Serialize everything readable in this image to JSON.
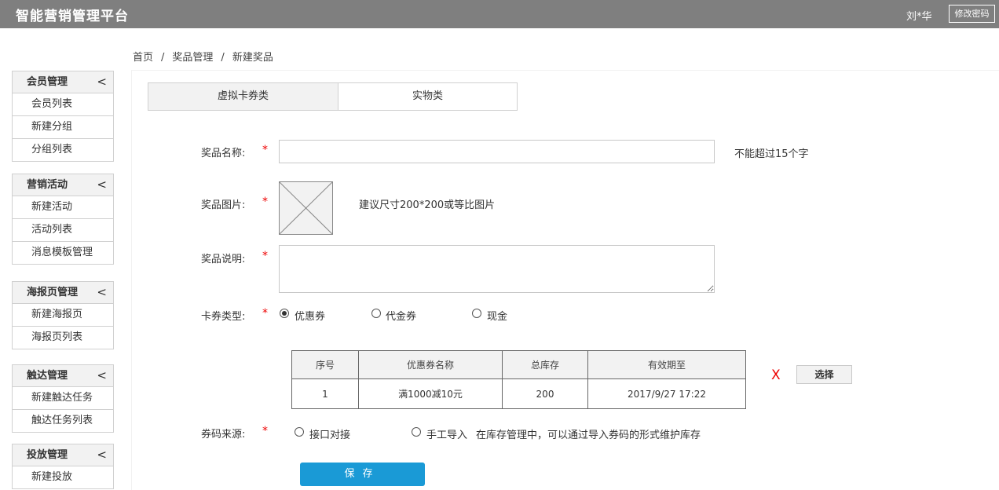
{
  "header": {
    "title": "智能营销管理平台",
    "user": "刘*华",
    "change_password": "修改密码"
  },
  "breadcrumb": {
    "items": [
      "首页",
      "奖品管理",
      "新建奖品"
    ],
    "separator": "/"
  },
  "sidebar": {
    "chevron": "<",
    "groups": [
      {
        "title": "会员管理",
        "items": [
          "会员列表",
          "新建分组",
          "分组列表"
        ]
      },
      {
        "title": "营销活动",
        "items": [
          "新建活动",
          "活动列表",
          "消息模板管理"
        ]
      },
      {
        "title": "海报页管理",
        "items": [
          "新建海报页",
          "海报页列表"
        ]
      },
      {
        "title": "触达管理",
        "items": [
          "新建触达任务",
          "触达任务列表"
        ]
      },
      {
        "title": "投放管理",
        "items": [
          "新建投放"
        ]
      }
    ]
  },
  "tabs": [
    {
      "label": "虚拟卡券类",
      "active": true
    },
    {
      "label": "实物类",
      "active": false
    }
  ],
  "form": {
    "required_mark": "*",
    "name": {
      "label": "奖品名称:",
      "value": "",
      "hint": "不能超过15个字"
    },
    "image": {
      "label": "奖品图片:",
      "hint": "建议尺寸200*200或等比图片"
    },
    "description": {
      "label": "奖品说明:",
      "value": ""
    },
    "card_type": {
      "label": "卡券类型:",
      "options": [
        "优惠券",
        "代金券",
        "现金"
      ],
      "selected": "优惠券"
    },
    "coupon_table": {
      "headers": [
        "序号",
        "优惠券名称",
        "总库存",
        "有效期至"
      ],
      "rows": [
        [
          "1",
          "满1000减10元",
          "200",
          "2017/9/27 17:22"
        ]
      ]
    },
    "remove_label": "X",
    "select_label": "选择",
    "code_source": {
      "label": "券码来源:",
      "options": [
        "接口对接",
        "手工导入"
      ],
      "selected": null,
      "hint": "在库存管理中，可以通过导入券码的形式维护库存"
    },
    "save_label": "保存"
  },
  "colors": {
    "topbar": "#7f7f7f",
    "accent": "#1a9ad6",
    "required": "#ee0000"
  }
}
